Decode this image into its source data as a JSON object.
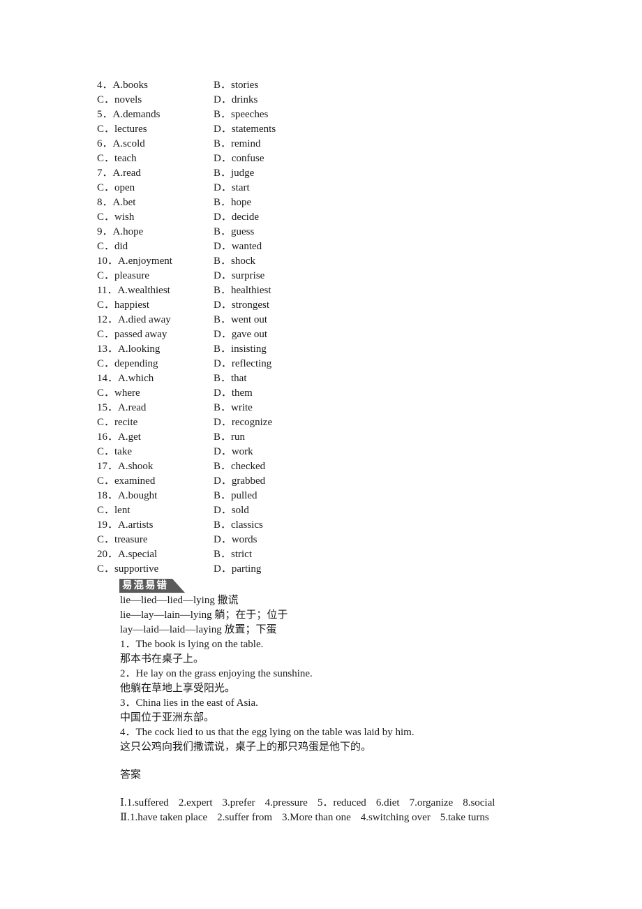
{
  "options": [
    {
      "left": "4．A.books",
      "right": "B．stories"
    },
    {
      "left": "C．novels",
      "right": "D．drinks"
    },
    {
      "left": "5．A.demands",
      "right": "B．speeches"
    },
    {
      "left": "C．lectures",
      "right": "D．statements"
    },
    {
      "left": "6．A.scold",
      "right": "B．remind"
    },
    {
      "left": "C．teach",
      "right": "D．confuse"
    },
    {
      "left": "7．A.read",
      "right": "B．judge"
    },
    {
      "left": "C．open",
      "right": "D．start"
    },
    {
      "left": "8．A.bet",
      "right": "B．hope"
    },
    {
      "left": "C．wish",
      "right": "D．decide"
    },
    {
      "left": "9．A.hope",
      "right": "B．guess"
    },
    {
      "left": "C．did",
      "right": "D．wanted"
    },
    {
      "left": "10．A.enjoyment",
      "right": "B．shock"
    },
    {
      "left": "C．pleasure",
      "right": "D．surprise"
    },
    {
      "left": "11．A.wealthiest",
      "right": "B．healthiest"
    },
    {
      "left": "C．happiest",
      "right": "D．strongest"
    },
    {
      "left": "12．A.died away",
      "right": "B．went out"
    },
    {
      "left": "C．passed away",
      "right": "D．gave out"
    },
    {
      "left": "13．A.looking",
      "right": "B．insisting"
    },
    {
      "left": "C．depending",
      "right": "D．reflecting"
    },
    {
      "left": "14．A.which",
      "right": "B．that"
    },
    {
      "left": "C．where",
      "right": "D．them"
    },
    {
      "left": "15．A.read",
      "right": "B．write"
    },
    {
      "left": "C．recite",
      "right": "D．recognize"
    },
    {
      "left": "16．A.get",
      "right": "B．run"
    },
    {
      "left": "C．take",
      "right": "D．work"
    },
    {
      "left": "17．A.shook",
      "right": "B．checked"
    },
    {
      "left": "C．examined",
      "right": "D．grabbed"
    },
    {
      "left": "18．A.bought",
      "right": "B．pulled"
    },
    {
      "left": "C．lent",
      "right": "D．sold"
    },
    {
      "left": "19．A.artists",
      "right": "B．classics"
    },
    {
      "left": "C．treasure",
      "right": "D．words"
    },
    {
      "left": "20．A.special",
      "right": "B．strict"
    },
    {
      "left": "C．supportive",
      "right": "D．parting"
    }
  ],
  "confusables": {
    "badge": "易混易错",
    "forms": [
      "lie—lied—lied—lying 撒谎",
      "lie—lay—lain—lying 躺；在于；位于",
      "lay—laid—laid—laying 放置；下蛋"
    ],
    "examples": [
      "1．The book is lying on the table.",
      "那本书在桌子上。",
      "2．He lay on the grass enjoying the sunshine.",
      "他躺在草地上享受阳光。",
      "3．China lies in the east of Asia.",
      "中国位于亚洲东部。",
      "4．The cock lied to us that the egg lying on the table was laid by him.",
      "这只公鸡向我们撒谎说，桌子上的那只鸡蛋是他下的。"
    ]
  },
  "answers": {
    "heading": "答案",
    "part1": {
      "label": "Ⅰ.",
      "items": [
        "1.suffered",
        "2.expert",
        "3.prefer",
        "4.pressure",
        "5．reduced",
        "6.diet",
        "7.organize",
        "8.social"
      ]
    },
    "part2": {
      "label": "Ⅱ.",
      "items": [
        "1.have taken place",
        "2.suffer from",
        "3.More than one",
        "4.switching over",
        "5.take turns"
      ]
    }
  }
}
